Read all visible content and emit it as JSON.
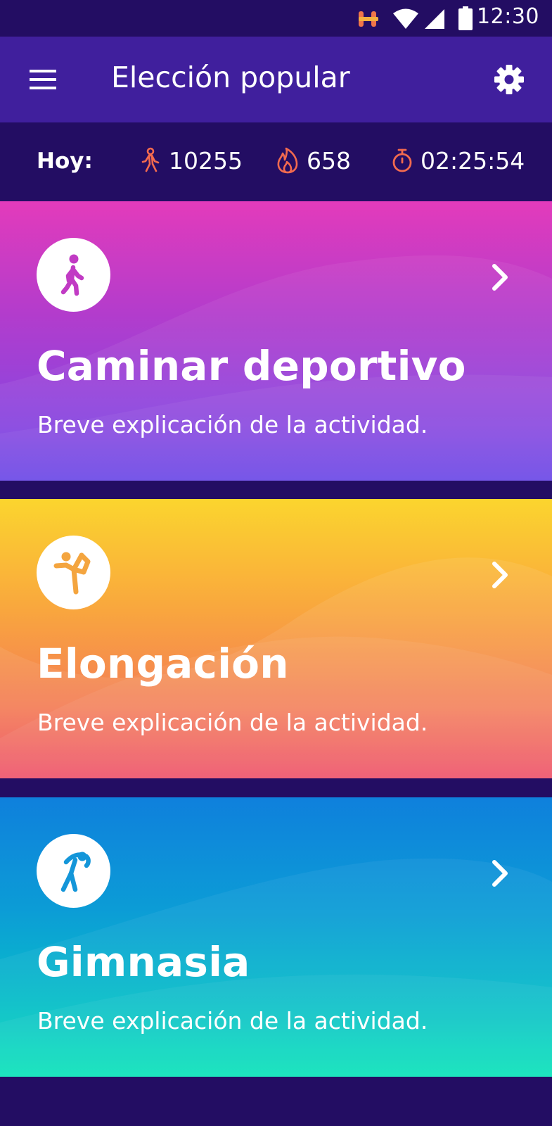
{
  "status_bar": {
    "time": "12:30",
    "icons": [
      "app-notification-icon",
      "wifi-icon",
      "cell-signal-icon",
      "battery-icon"
    ]
  },
  "app_bar": {
    "menu_icon": "menu-icon",
    "title": "Elección popular",
    "settings_icon": "gear-icon"
  },
  "stats": {
    "label": "Hoy:",
    "steps": {
      "icon": "walking-person-icon",
      "value": "10255"
    },
    "calories": {
      "icon": "flame-icon",
      "value": "658"
    },
    "duration": {
      "icon": "stopwatch-icon",
      "value": "02:25:54"
    },
    "accent_color": "#f26a4f"
  },
  "activities": [
    {
      "title": "Caminar deportivo",
      "description": "Breve explicación de la actividad.",
      "icon": "walking-person-icon",
      "color": "#c53bc6"
    },
    {
      "title": "Elongación",
      "description": "Breve explicación de la actividad.",
      "icon": "stretching-person-icon",
      "color": "#f9a63e"
    },
    {
      "title": "Gimnasia",
      "description": "Breve explicación de la actividad.",
      "icon": "exercise-person-icon",
      "color": "#0f90d8"
    }
  ],
  "colors": {
    "background": "#230d63",
    "app_bar": "#401f9d"
  }
}
